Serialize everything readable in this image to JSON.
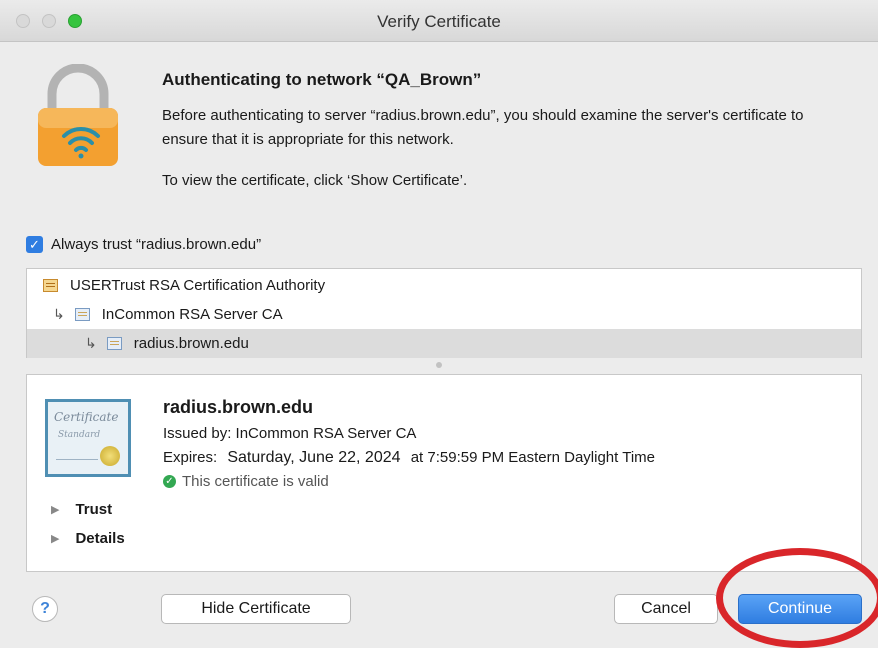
{
  "window": {
    "title": "Verify Certificate"
  },
  "message": {
    "heading": "Authenticating to network “QA_Brown”",
    "body": "Before authenticating to server “radius.brown.edu”, you should examine the server's certificate to ensure that it is appropriate for this network.",
    "instruction": "To view the certificate, click ‘Show Certificate’."
  },
  "always_trust": {
    "label": "Always trust “radius.brown.edu”",
    "checked": true
  },
  "chain": [
    {
      "label": "USERTrust RSA Certification Authority"
    },
    {
      "label": "InCommon RSA Server CA"
    },
    {
      "label": "radius.brown.edu"
    }
  ],
  "certificate": {
    "image_script": "Certificate",
    "image_sub": "Standard",
    "common_name": "radius.brown.edu",
    "issued_by": "Issued by: InCommon RSA Server CA",
    "expires_label": "Expires:",
    "expires_date": "Saturday, June 22, 2024",
    "expires_time": "at 7:59:59 PM Eastern Daylight Time",
    "status": "This certificate is valid"
  },
  "sections": {
    "trust": "Trust",
    "details": "Details"
  },
  "buttons": {
    "help": "?",
    "hide_certificate": "Hide Certificate",
    "cancel": "Cancel",
    "continue": "Continue"
  },
  "colors": {
    "accent": "#2f7de1",
    "annotation": "#d9262a",
    "valid": "#33a852"
  }
}
